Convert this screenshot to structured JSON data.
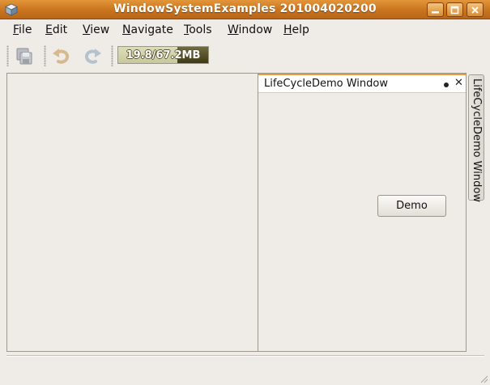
{
  "window": {
    "title": "WindowSystemExamples 201004020200",
    "icons": [
      "app-icon",
      "minimize-icon",
      "maximize-icon",
      "close-icon"
    ]
  },
  "menubar": {
    "items": [
      {
        "mnemonic": "F",
        "rest": "ile"
      },
      {
        "mnemonic": "E",
        "rest": "dit"
      },
      {
        "mnemonic": "V",
        "rest": "iew"
      },
      {
        "mnemonic": "N",
        "rest": "avigate"
      },
      {
        "mnemonic": "T",
        "rest": "ools"
      },
      {
        "mnemonic": "W",
        "rest": "indow"
      },
      {
        "mnemonic": "H",
        "rest": "elp"
      }
    ]
  },
  "toolbar": {
    "icons": [
      "save-all-icon",
      "undo-icon",
      "redo-icon"
    ],
    "memory": {
      "text": "19.8/67.2MB",
      "used_mb": 19.8,
      "total_mb": 67.2
    }
  },
  "document": {
    "tab_label": "LifeCycleDemo Window",
    "demo_button": "Demo"
  },
  "side_tab": {
    "label": "LifeCycleDemo Window"
  },
  "colors": {
    "title_bar": "#c9741e",
    "active_tab_accent": "#e79a3e",
    "memory_used": "#4f4a24"
  }
}
